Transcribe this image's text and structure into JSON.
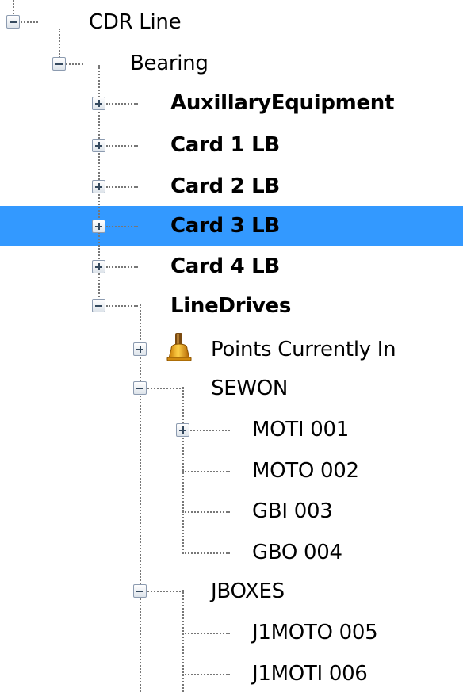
{
  "tree": {
    "root": {
      "label": "CDR Line",
      "expanded": true
    },
    "bearing": {
      "label": "Bearing",
      "expanded": true
    },
    "cards": [
      {
        "label": "AuxillaryEquipment",
        "expanded": false,
        "selected": false
      },
      {
        "label": "Card 1 LB",
        "expanded": false,
        "selected": false
      },
      {
        "label": "Card 2 LB",
        "expanded": false,
        "selected": false
      },
      {
        "label": "Card 3 LB",
        "expanded": false,
        "selected": true
      },
      {
        "label": "Card 4 LB",
        "expanded": false,
        "selected": false
      }
    ],
    "linedrives": {
      "label": "LineDrives",
      "expanded": true
    },
    "points": {
      "label": "Points Currently In",
      "icon": "bell-icon",
      "expanded": false
    },
    "sewon": {
      "label": "SEWON",
      "expanded": true,
      "children": [
        {
          "label": "MOTI 001",
          "expandable": true
        },
        {
          "label": "MOTO 002",
          "expandable": false
        },
        {
          "label": "GBI 003",
          "expandable": false
        },
        {
          "label": "GBO 004",
          "expandable": false
        }
      ]
    },
    "jboxes": {
      "label": "JBOXES",
      "expanded": true,
      "children": [
        {
          "label": "J1MOTO 005"
        },
        {
          "label": "J1MOTI 006"
        }
      ]
    }
  },
  "colors": {
    "selection": "#3399ff",
    "connector": "#777777"
  }
}
